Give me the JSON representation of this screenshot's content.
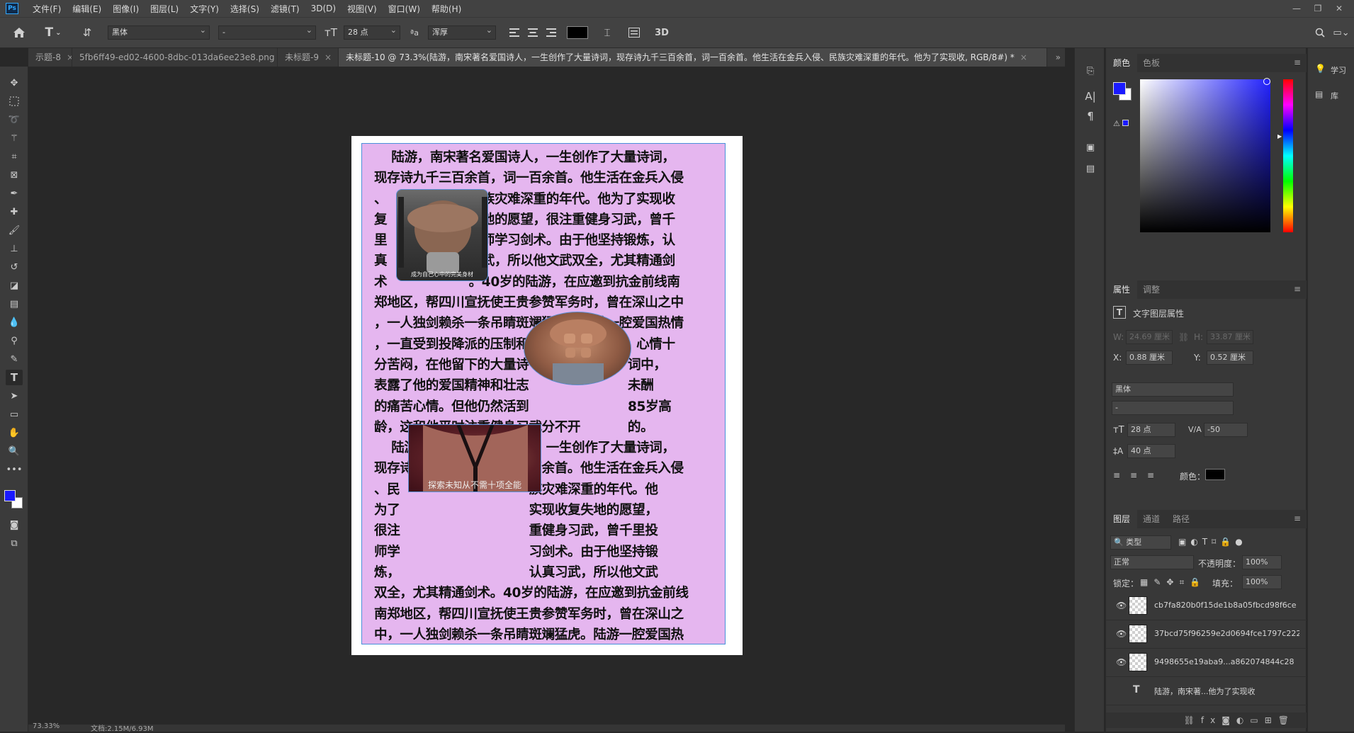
{
  "app": {
    "logo": "Ps"
  },
  "menu": [
    "文件(F)",
    "编辑(E)",
    "图像(I)",
    "图层(L)",
    "文字(Y)",
    "选择(S)",
    "滤镜(T)",
    "3D(D)",
    "视图(V)",
    "窗口(W)",
    "帮助(H)"
  ],
  "window_controls": [
    "—",
    "❐",
    "✕"
  ],
  "options": {
    "font_family": "黑体",
    "font_style": "-",
    "font_size": "28 点",
    "anti_alias": "浑厚",
    "mode_3d": "3D",
    "text_color": "#000000"
  },
  "tabs": [
    {
      "label": "示题-8",
      "close": "×"
    },
    {
      "label": "5fb6ff49-ed02-4600-8dbc-013da6ee23e8.png",
      "close": "×"
    },
    {
      "label": "未标题-9",
      "close": "×"
    },
    {
      "label": "未标题-10 @ 73.3%(陆游，南宋著名爱国诗人，一生创作了大量诗词，现存诗九千三百余首，词一百余首。他生活在金兵入侵、民族灾难深重的年代。他为了实现收, RGB/8#) *",
      "close": "×"
    }
  ],
  "document": {
    "lines": [
      "    陆游，南宋著名爱国诗人，一生创作了大量诗词，",
      "现存诗九千三百余首，词一百余首。他生活在金兵入侵",
      "、                   民族灾难深重的年代。他为了实现收",
      "复                   失地的愿望，很注重健身习武，曾千",
      "里                   投师学习剑术。由于他坚持锻炼，认",
      "真                   习武，所以他文武双全，尤其精通剑",
      "术                   。40岁的陆游，在应邀到抗金前线南",
      "郑地区，帮四川宣抚使王贵参赞军务时，曾在深山之中",
      "，一人独剑赖杀一条吊睛斑斓猛虎。陆游一腔爱国热情",
      "，一直受到投降派的压制和打击                ，心情十",
      "分苦闷，在他留下的大量诗                       词中，",
      "表露了他的爱国精神和壮志                       未酬",
      "的痛苦心情。但他仍然活到                       85岁高",
      "龄，这和他平时注重健身习武分不开           的。",
      "    陆游，南宋著名爱国诗人，一生创作了大量诗词，",
      "现存诗九千三百余首，词一百余首。他生活在金兵入侵",
      "、民                              族灾难深重的年代。他",
      "为了                              实现收复失地的愿望，",
      "很注                              重健身习武，曾千里投",
      "师学                              习剑术。由于他坚持锻",
      "炼，                              认真习武，所以他文武",
      "双全，尤其精通剑术。40岁的陆游，在应邀到抗金前线",
      "南郑地区，帮四川宣抚使王贵参赞军务时，曾在深山之",
      "中，一人独剑赖杀一条吊睛斑斓猛虎。陆游一腔爱国热"
    ],
    "img_caption_1": "成为自己心中的完美身材",
    "img_caption_3": "探索未知从不需十项全能"
  },
  "status": {
    "zoom": "73.33%",
    "doc": "文档:2.15M/6.93M"
  },
  "color_panel": {
    "tabs": [
      "颜色",
      "色板"
    ],
    "fg": "#1a1aff",
    "bg": "#ffffff"
  },
  "properties": {
    "tabs": [
      "属性",
      "调整"
    ],
    "title": "文字图层属性",
    "w_label": "W:",
    "w": "24.69 厘米",
    "h_label": "H:",
    "h": "33.87 厘米",
    "x_label": "X:",
    "x": "0.88 厘米",
    "y_label": "Y:",
    "y": "0.52 厘米",
    "font": "黑体",
    "style": "-",
    "size": "28 点",
    "tracking": "-50",
    "leading": "40 点",
    "color_label": "颜色："
  },
  "layers": {
    "tabs": [
      "图层",
      "通道",
      "路径"
    ],
    "filter": "类型",
    "blend": "正常",
    "opacity_label": "不透明度：",
    "opacity": "100%",
    "lock_label": "锁定：",
    "fill_label": "填充：",
    "fill": "100%",
    "items": [
      {
        "name": "cb7fa820b0f15de1b8a05fbcd98f6ce",
        "visible": "👁"
      },
      {
        "name": "37bcd75f96259e2d0694fce1797c222",
        "visible": "👁"
      },
      {
        "name": "9498655e19aba9...a862074844c28",
        "visible": "👁"
      },
      {
        "name": "陆游，南宋著...他为了实现收",
        "visible": ""
      }
    ]
  },
  "far": {
    "learn": "学习",
    "library": "库"
  }
}
